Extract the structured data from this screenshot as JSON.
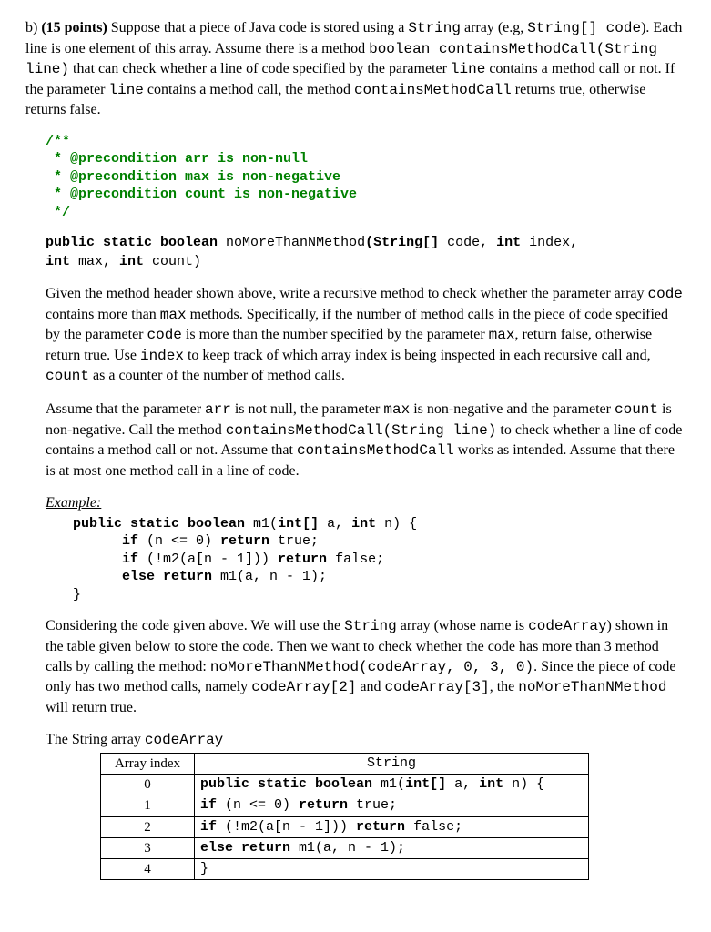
{
  "label": "b)",
  "points": "(15 points)",
  "intro1a": " Suppose that a piece of Java code is stored using a ",
  "intro1b": "String",
  "intro1c": " array (e.g, ",
  "intro1d": "String[] code",
  "intro1e": "). Each line is one element of this array. Assume there is a method ",
  "intro1f": "boolean containsMethodCall(String line)",
  "intro1g": " that can check whether a line of code specified by the parameter ",
  "intro1h": "line",
  "intro1i": " contains a method call or not. If the parameter ",
  "intro1j": "line",
  "intro1k": " contains a method call, the method ",
  "intro1l": "containsMethodCall",
  "intro1m": " returns true, otherwise returns false.",
  "javadoc": {
    "l1": "/**",
    "l2": " * @precondition arr is non-null",
    "l3": " * @precondition max is non-negative",
    "l4": " * @precondition count is non-negative",
    "l5": " */"
  },
  "sig": {
    "kw1": "public static boolean ",
    "name": "noMoreThanNMethod",
    "paren": "(",
    "t1": "String[] ",
    "p1": "code, ",
    "t2": "int ",
    "p2": "index, ",
    "t3": "int ",
    "p3": "max, ",
    "t4": "int ",
    "p4": "count)"
  },
  "p2a": "Given the method header shown above, write a recursive method to check whether the parameter array ",
  "p2b": "code",
  "p2c": " contains more than ",
  "p2d": "max",
  "p2e": " methods. Specifically, if the number of method calls in the piece of code specified by the parameter ",
  "p2f": "code",
  "p2g": " is more than the number specified by the parameter ",
  "p2h": "max",
  "p2i": ", return false, otherwise return true. Use ",
  "p2j": "index",
  "p2k": " to keep track of which array index is being inspected in each recursive call and, ",
  "p2l": "count",
  "p2m": " as a counter of the number of method calls.",
  "p3a": "Assume that the parameter ",
  "p3b": "arr",
  "p3c": " is not null, the parameter ",
  "p3d": "max",
  "p3e": " is non-negative and the parameter ",
  "p3f": "count",
  "p3g": " is non-negative. Call the method ",
  "p3h": "containsMethodCall(String line)",
  "p3i": " to check whether a line of code contains a method call or not.  Assume that ",
  "p3j": "containsMethodCall",
  "p3k": " works as intended. Assume that there is at most one method call in a line of code.",
  "example_label": "Example:",
  "ex": {
    "l1a": "public static boolean ",
    "l1b": "m1(",
    "l1c": "int[] ",
    "l1d": "a, ",
    "l1e": "int ",
    "l1f": "n) {",
    "l2a": "      if ",
    "l2b": "(n <= 0) ",
    "l2c": "return ",
    "l2d": "true;",
    "l3a": "      if ",
    "l3b": "(!m2(a[n - 1])) ",
    "l3c": "return ",
    "l3d": "false;",
    "l4a": "      else return ",
    "l4b": "m1(a, n - 1);",
    "l5": "}"
  },
  "p4a": "Considering the code given above. We will use the ",
  "p4b": "String",
  "p4c": " array (whose name is ",
  "p4d": "codeArray",
  "p4e": ") shown in the table given below to store the code.  Then we want to check whether the code has more than 3 method calls by calling the method: ",
  "p4f": "noMoreThanNMethod(codeArray, 0, 3, 0)",
  "p4g": ". Since the piece of code only has two method calls, namely ",
  "p4h": "codeArray[2]",
  "p4i": " and ",
  "p4j": "codeArray[3]",
  "p4k": ", the ",
  "p4l": "noMoreThanNMethod",
  "p4m": " will return true.",
  "table_caption_a": "The String array ",
  "table_caption_b": "codeArray",
  "table": {
    "h1": "Array index",
    "h2": "String",
    "rows": [
      {
        "idx": "0",
        "c": [
          {
            "t": "public static boolean ",
            "b": true
          },
          {
            "t": "m1(",
            "b": false
          },
          {
            "t": "int[] ",
            "b": true
          },
          {
            "t": "a, ",
            "b": false
          },
          {
            "t": "int ",
            "b": true
          },
          {
            "t": "n) {",
            "b": false
          }
        ]
      },
      {
        "idx": "1",
        "c": [
          {
            "t": "if ",
            "b": true
          },
          {
            "t": "(n <= 0) ",
            "b": false
          },
          {
            "t": "return ",
            "b": true
          },
          {
            "t": "true;",
            "b": false
          }
        ]
      },
      {
        "idx": "2",
        "c": [
          {
            "t": "if ",
            "b": true
          },
          {
            "t": "(!m2(a[n - 1])) ",
            "b": false
          },
          {
            "t": "return ",
            "b": true
          },
          {
            "t": "false;",
            "b": false
          }
        ]
      },
      {
        "idx": "3",
        "c": [
          {
            "t": "else return ",
            "b": true
          },
          {
            "t": "m1(a, n - 1);",
            "b": false
          }
        ]
      },
      {
        "idx": "4",
        "c": [
          {
            "t": "}",
            "b": false
          }
        ]
      }
    ]
  }
}
